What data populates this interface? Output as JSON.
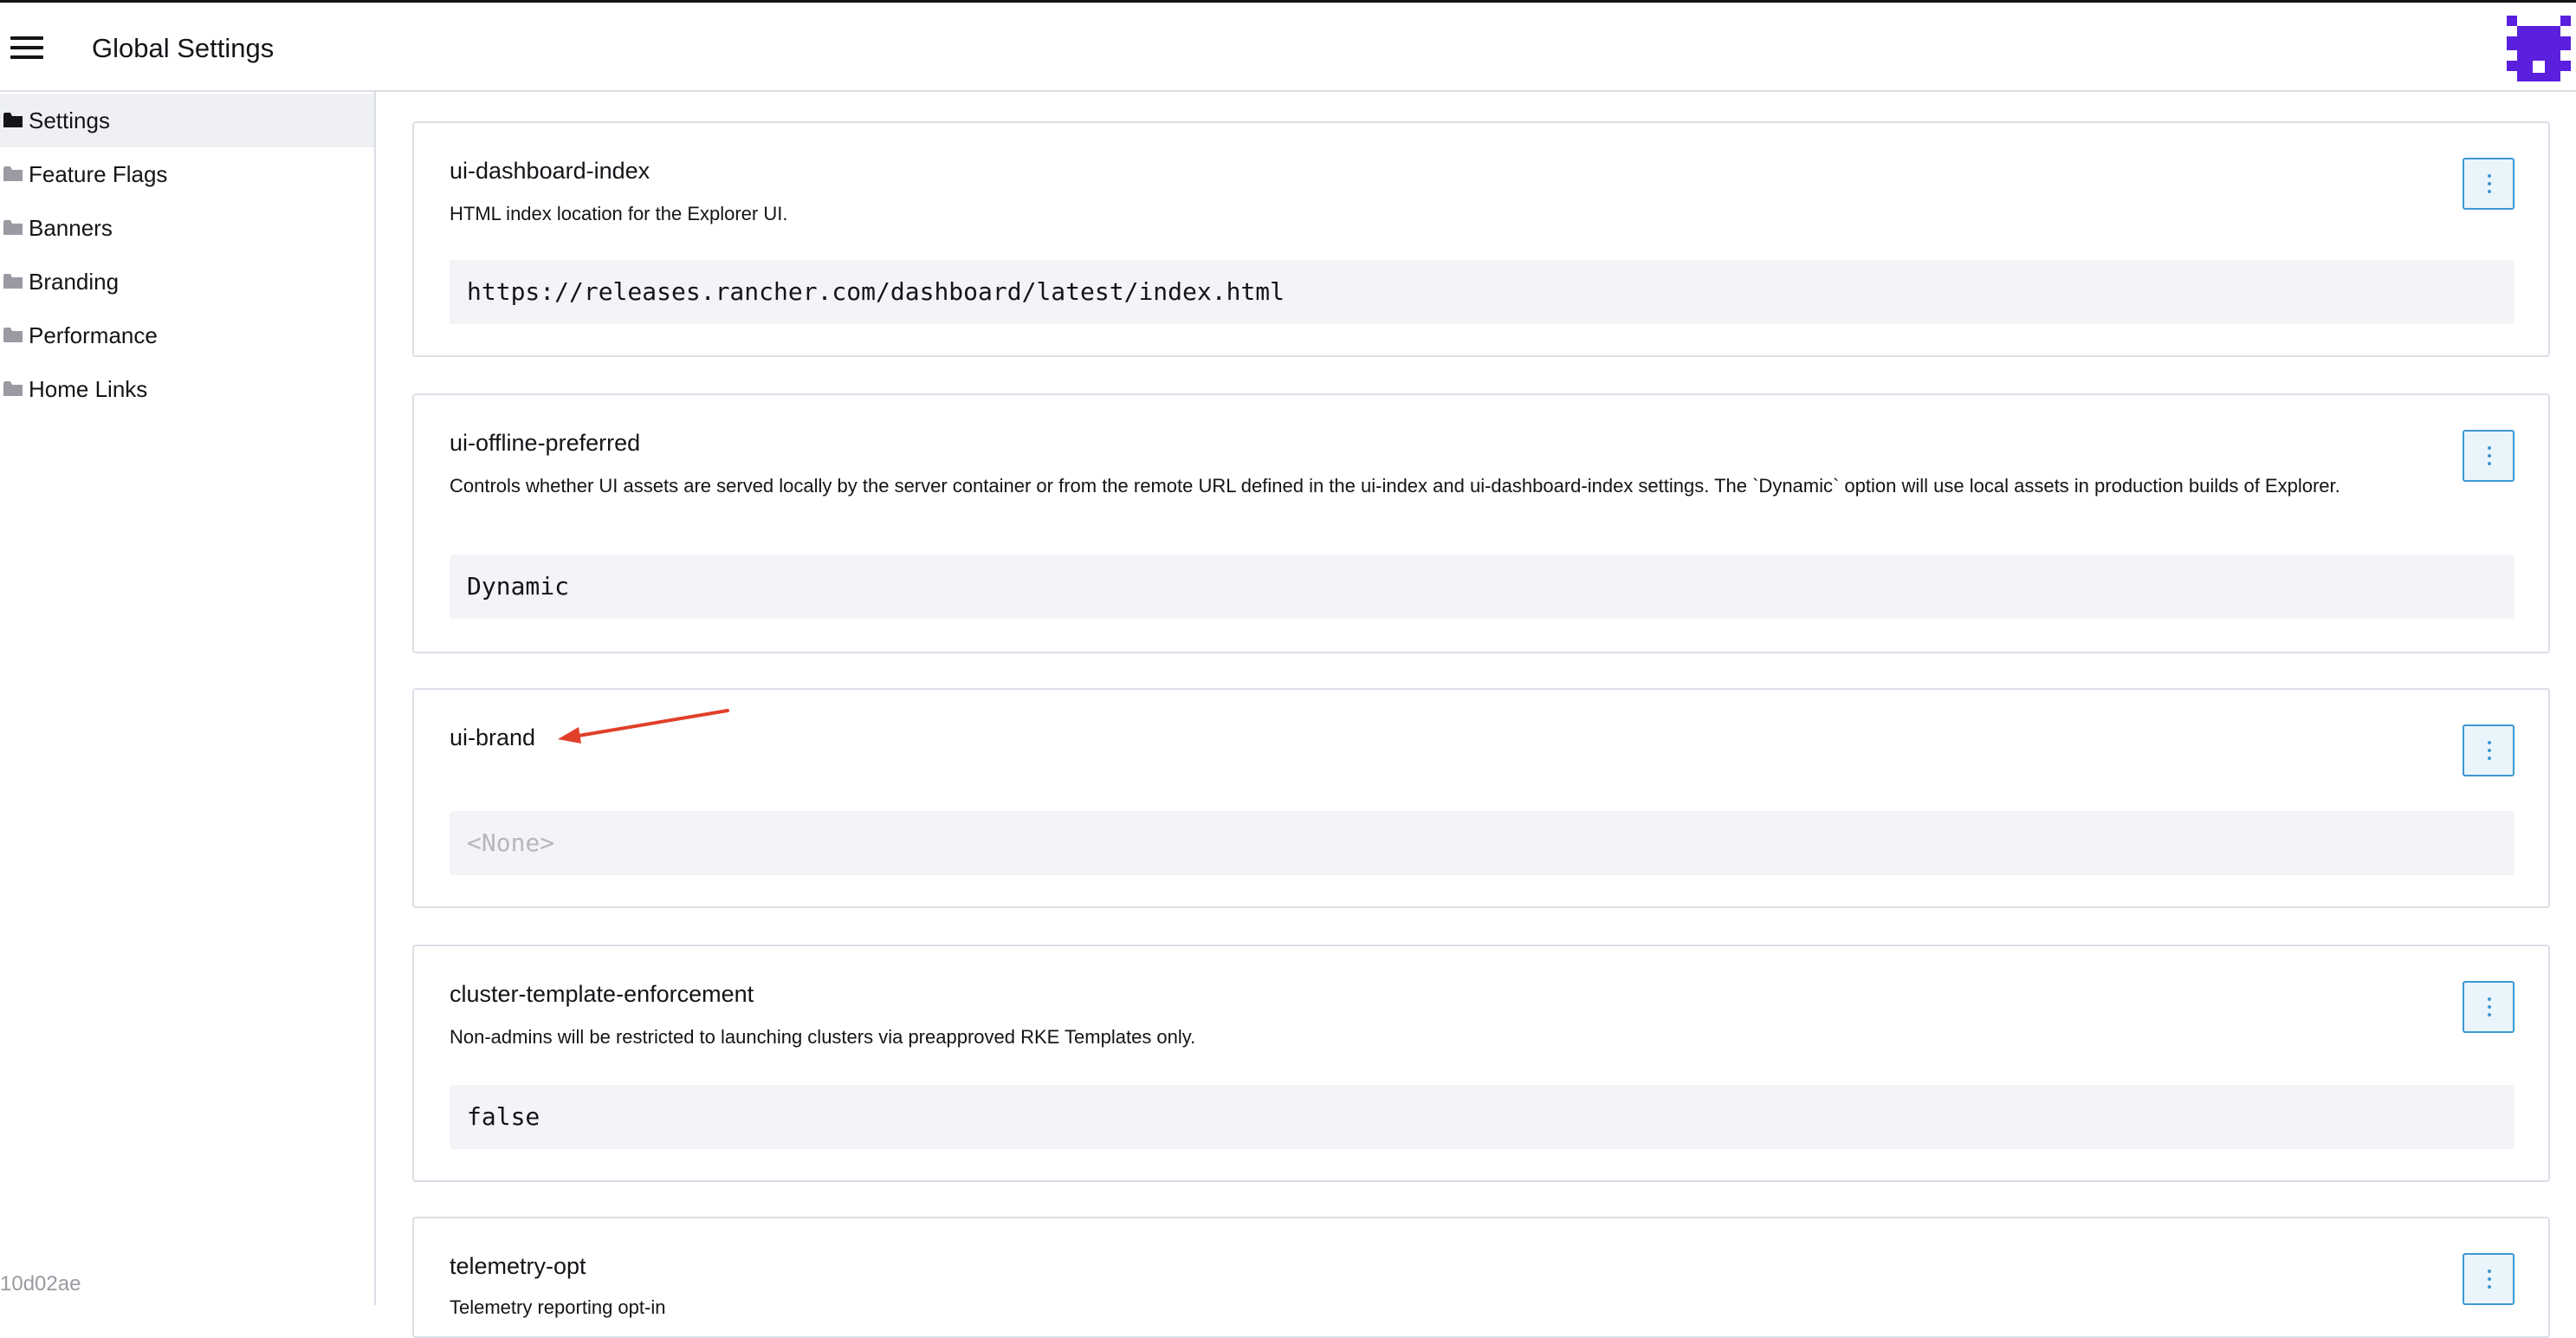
{
  "header": {
    "title": "Global Settings"
  },
  "sidebar": {
    "items": [
      {
        "label": "Settings",
        "active": true
      },
      {
        "label": "Feature Flags"
      },
      {
        "label": "Banners"
      },
      {
        "label": "Branding"
      },
      {
        "label": "Performance"
      },
      {
        "label": "Home Links"
      }
    ],
    "commit": "10d02ae"
  },
  "settings": [
    {
      "name": "ui-dashboard-index",
      "description": "HTML index location for the Explorer UI.",
      "value": "https://releases.rancher.com/dashboard/latest/index.html"
    },
    {
      "name": "ui-offline-preferred",
      "description": "Controls whether UI assets are served locally by the server container or from the remote URL defined in the ui-index and ui-dashboard-index settings. The `Dynamic` option will use local assets in production builds of Explorer.",
      "value": "Dynamic"
    },
    {
      "name": "ui-brand",
      "description": "",
      "value": "<None>"
    },
    {
      "name": "cluster-template-enforcement",
      "description": "Non-admins will be restricted to launching clusters via preapproved RKE Templates only.",
      "value": "false"
    },
    {
      "name": "telemetry-opt",
      "description": "Telemetry reporting opt-in"
    }
  ],
  "colors": {
    "accent": "#3d98d3",
    "avatar": "#5b1fde",
    "annotation_arrow": "#e0402a"
  },
  "icons": {
    "menu": "hamburger-icon",
    "folder": "folder-icon",
    "more": "kebab-menu-icon",
    "avatar": "user-avatar-icon"
  }
}
